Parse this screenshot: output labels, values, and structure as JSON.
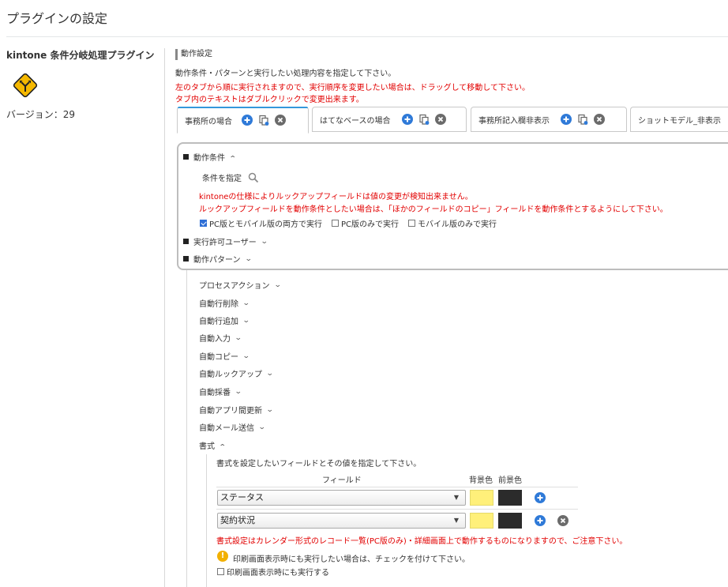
{
  "page": {
    "title": "プラグインの設定"
  },
  "plugin": {
    "name": "kintone 条件分岐処理プラグイン",
    "version": "バージョン：29"
  },
  "section": {
    "label": "動作設定",
    "desc1": "動作条件・パターンと実行したい処理内容を指定して下さい。",
    "desc2": "左のタブから順に実行されますので、実行順序を変更したい場合は、ドラッグして移動して下さい。",
    "desc3": "タブ内のテキストはダブルクリックで変更出来ます。"
  },
  "tabs": [
    {
      "label": "事務所の場合"
    },
    {
      "label": "はてなベースの場合"
    },
    {
      "label": "事務所記入欄非表示"
    },
    {
      "label": "ショットモデル_非表示"
    }
  ],
  "conditions": {
    "heading": "動作条件",
    "specify_label": "条件を指定",
    "note1": "kintoneの仕様によりルックアップフィールドは値の変更が検知出来ません。",
    "note2": "ルックアップフィールドを動作条件としたい場合は、「ほかのフィールドのコピー」フィールドを動作条件とするようにして下さい。",
    "options": [
      {
        "label": "PC版とモバイル版の両方で実行",
        "checked": true
      },
      {
        "label": "PC版のみで実行",
        "checked": false
      },
      {
        "label": "モバイル版のみで実行",
        "checked": false
      }
    ],
    "allowed_users": "実行許可ユーザー",
    "pattern": "動作パターン"
  },
  "actions": [
    "プロセスアクション",
    "自動行削除",
    "自動行追加",
    "自動入力",
    "自動コピー",
    "自動ルックアップ",
    "自動採番",
    "自動アプリ間更新",
    "自動メール送信"
  ],
  "format": {
    "heading": "書式",
    "desc": "書式を設定したいフィールドとその値を指定して下さい。",
    "col_field": "フィールド",
    "col_bg": "背景色",
    "col_fg": "前景色",
    "rows": [
      {
        "field": "ステータス",
        "bg": "#fff07a",
        "fg": "#2b2b2b"
      },
      {
        "field": "契約状況",
        "bg": "#fff07a",
        "fg": "#2b2b2b"
      }
    ],
    "note": "書式設定はカレンダー形式のレコード一覧(PC版のみ)・詳細画面上で動作するものになりますので、ご注意下さい。",
    "print_note": "印刷画面表示時にも実行したい場合は、チェックを付けて下さい。",
    "print_checkbox": "印刷画面表示時にも実行する"
  },
  "colors": {
    "accent": "#3498db",
    "red": "#e20000",
    "add_blue": "#2f7ad8",
    "delete_gray": "#6b6b6b"
  }
}
